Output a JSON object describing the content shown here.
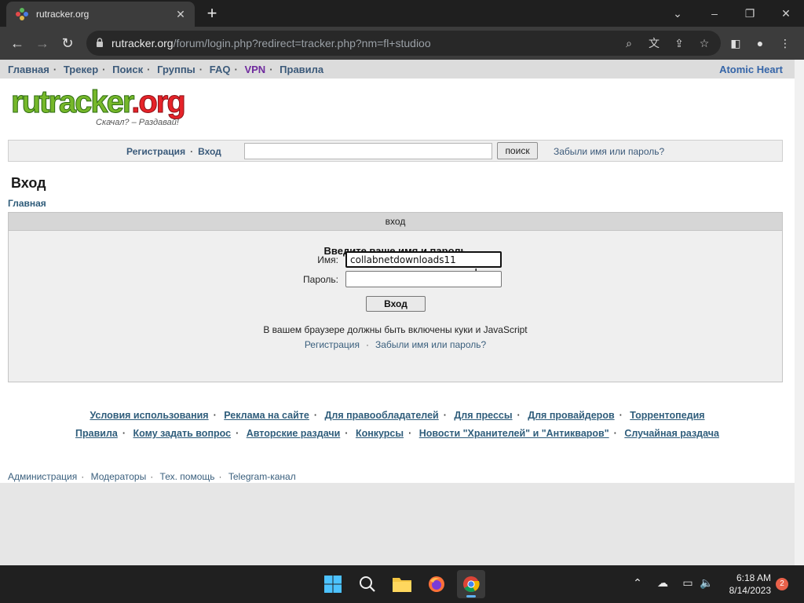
{
  "browser": {
    "tab_title": "rutracker.org",
    "url_host": "rutracker.org",
    "url_path": "/forum/login.php?redirect=tracker.php?nm=fl+studioo"
  },
  "topnav": {
    "items": [
      "Главная",
      "Трекер",
      "Поиск",
      "Группы",
      "FAQ",
      "VPN",
      "Правила"
    ],
    "right": "Atomic Heart"
  },
  "logo": {
    "left": "rutracker",
    "right": ".org",
    "slogan": "Скачал? – Раздавай!"
  },
  "searchbar": {
    "register": "Регистрация",
    "login": "Вход",
    "search_button": "поиск",
    "forgot": "Забыли имя или пароль?"
  },
  "page": {
    "title": "Вход",
    "breadcrumb": "Главная"
  },
  "login": {
    "header": "вход",
    "title": "Введите ваше имя и пароль",
    "username_label": "Имя:",
    "username_value": "collabnetdownloads11",
    "password_label": "Пароль:",
    "password_value": "",
    "submit": "Вход",
    "note": "В вашем браузере должны быть включены куки и JavaScript",
    "register": "Регистрация",
    "forgot": "Забыли имя или пароль?"
  },
  "footer": {
    "row1": [
      "Условия использования",
      "Реклама на сайте",
      "Для правообладателей",
      "Для прессы",
      "Для провайдеров",
      "Торрентопедия"
    ],
    "row2": [
      "Правила",
      "Кому задать вопрос",
      "Авторские раздачи",
      "Конкурсы",
      "Новости \"Хранителей\" и \"Антикваров\"",
      "Случайная раздача"
    ],
    "bottom": [
      "Администрация",
      "Модераторы",
      "Тех. помощь",
      "Telegram-канал"
    ]
  },
  "taskbar": {
    "time": "6:18 AM",
    "date": "8/14/2023",
    "notifications": "2"
  },
  "colors": {
    "link": "#2f5d7b",
    "vpn": "#6f2b9e",
    "accent": "#3565a8"
  }
}
